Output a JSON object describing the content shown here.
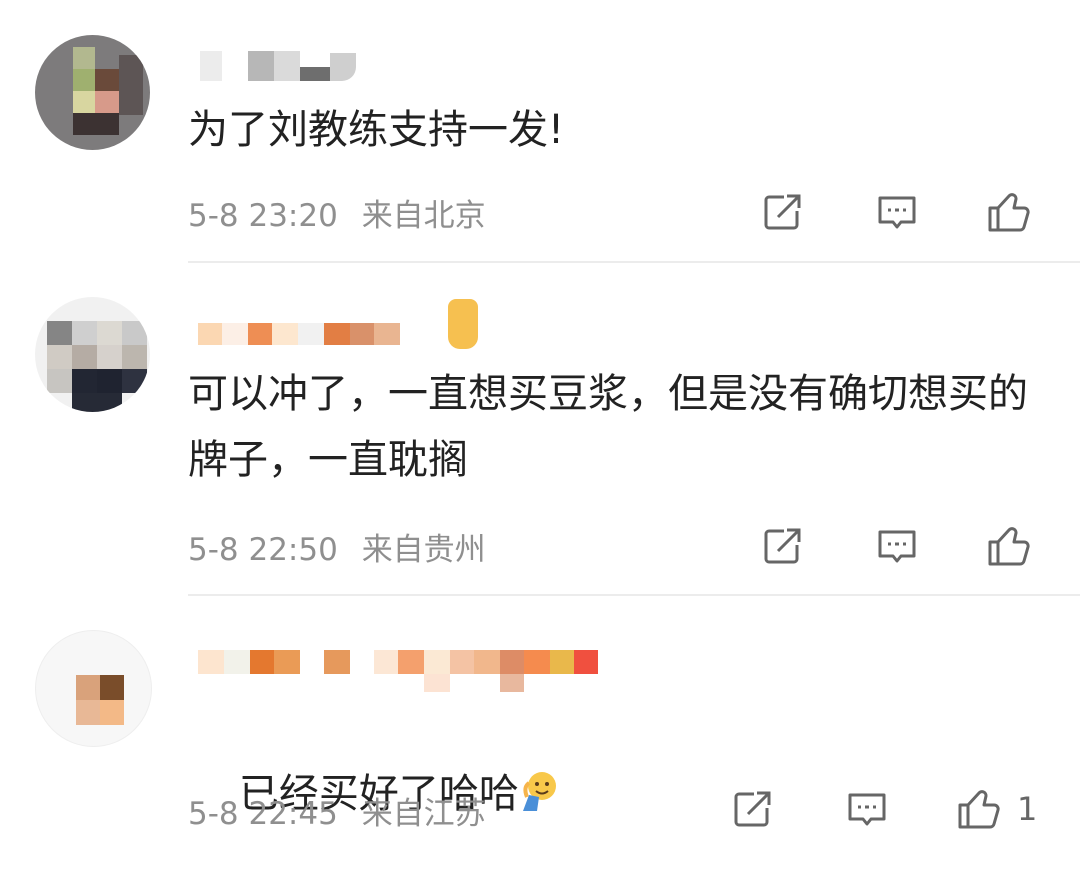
{
  "comments": [
    {
      "text": "为了刘教练支持一发!",
      "date": "5-8 23:20",
      "location": "来自北京",
      "likes": ""
    },
    {
      "text": "可以冲了，一直想买豆浆，但是没有确切想买的牌子，一直耽搁",
      "date": "5-8 22:50",
      "location": "来自贵州",
      "likes": ""
    },
    {
      "text": "已经买好了哈哈",
      "date": "5-8 22:45",
      "location": "来自江苏",
      "likes": "1"
    }
  ],
  "icons": {
    "share": "share-icon",
    "reply": "comment-icon",
    "like": "thumbs-up-icon",
    "emoji": "waving-hand-emoji"
  }
}
